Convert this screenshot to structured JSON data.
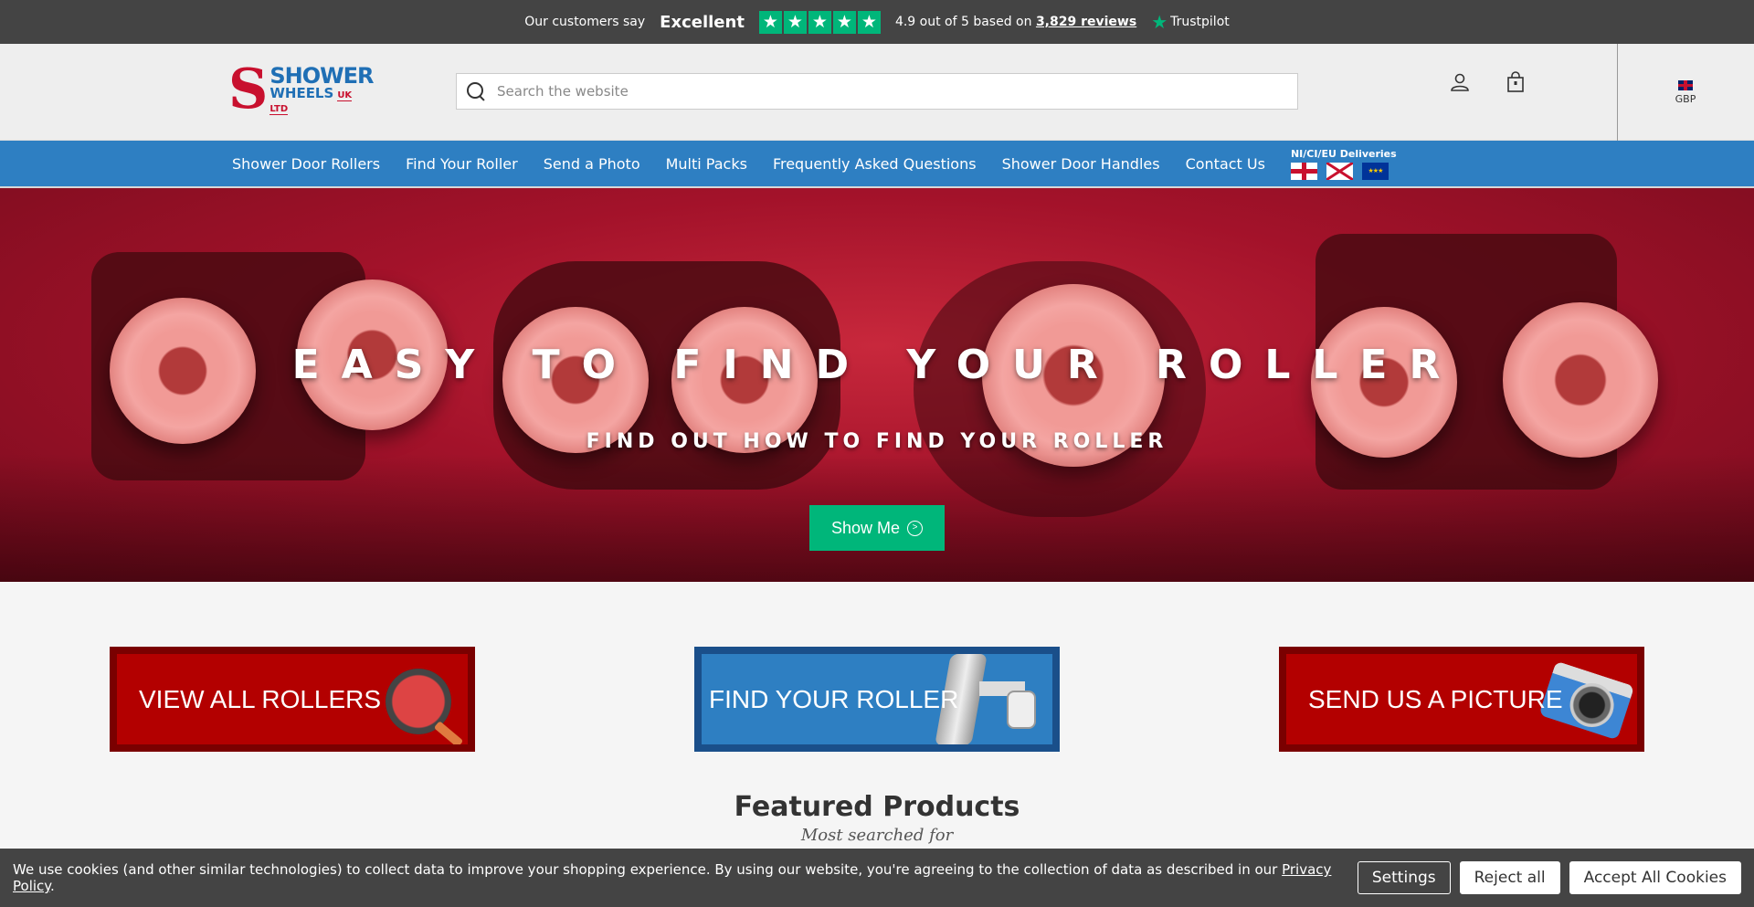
{
  "trustpilot": {
    "say": "Our customers say",
    "rating_word": "Excellent",
    "score_text": "4.9 out of 5 based on",
    "reviews_link": "3,829 reviews",
    "brand": "Trustpilot",
    "stars": 5
  },
  "header": {
    "logo_line1": "SHOWER",
    "logo_line2": "WHEELS",
    "logo_line3": "UK LTD",
    "search_placeholder": "Search the website",
    "currency": "GBP"
  },
  "nav": {
    "items": [
      "Shower Door Rollers",
      "Find Your Roller",
      "Send a Photo",
      "Multi Packs",
      "Frequently Asked Questions",
      "Shower Door Handles",
      "Contact Us"
    ],
    "deliveries_label": "NI/CI/EU Deliveries"
  },
  "hero": {
    "title": "EASY TO FIND YOUR ROLLER",
    "subtitle": "FIND OUT HOW TO FIND YOUR ROLLER",
    "button": "Show Me"
  },
  "banners": [
    {
      "label": "VIEW ALL ROLLERS",
      "color": "#b30000"
    },
    {
      "label": "FIND YOUR ROLLER",
      "color": "#2e7fc2"
    },
    {
      "label": "SEND US A PICTURE",
      "color": "#b30000"
    }
  ],
  "featured": {
    "title": "Featured Products",
    "subtitle": "Most searched for"
  },
  "cookie": {
    "text": "We use cookies (and other similar technologies) to collect data to improve your shopping experience. By using our website, you're agreeing to the collection of data as described in our",
    "link": "Privacy Policy",
    "settings": "Settings",
    "reject": "Reject all",
    "accept": "Accept All Cookies"
  },
  "colors": {
    "nav_blue": "#2e7fc2",
    "trustpilot_green": "#00b67a",
    "brand_red": "#c8102e",
    "dark_bar": "#444444"
  }
}
